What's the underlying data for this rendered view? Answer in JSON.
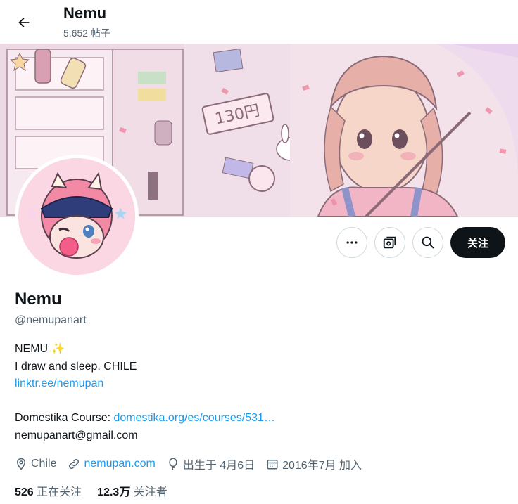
{
  "header": {
    "title": "Nemu",
    "post_count": "5,652 帖子",
    "back_icon": "arrow-left-icon"
  },
  "profile": {
    "name": "Nemu",
    "handle": "@nemupanart",
    "actions": {
      "more_icon": "more-icon",
      "subscribe_icon": "subscribe-icon",
      "search_icon": "search-icon",
      "follow_label": "关注"
    }
  },
  "bio": {
    "line1": "NEMU ✨",
    "line2": "I draw and sleep. CHILE",
    "link1": "linktr.ee/nemupan",
    "course_label": "Domestika Course: ",
    "course_link": "domestika.org/es/courses/531…",
    "email": "nemupanart@gmail.com"
  },
  "meta": {
    "location": "Chile",
    "website": "nemupan.com",
    "birthday": "出生于 4月6日",
    "joined": "2016年7月 加入"
  },
  "stats": {
    "following_count": "526",
    "following_label": "正在关注",
    "followers_count": "12.3万",
    "followers_label": "关注者"
  },
  "colors": {
    "accent": "#1d9bf0",
    "text": "#0f1419",
    "secondary": "#536471",
    "banner_bg": "#f3dfe6"
  }
}
